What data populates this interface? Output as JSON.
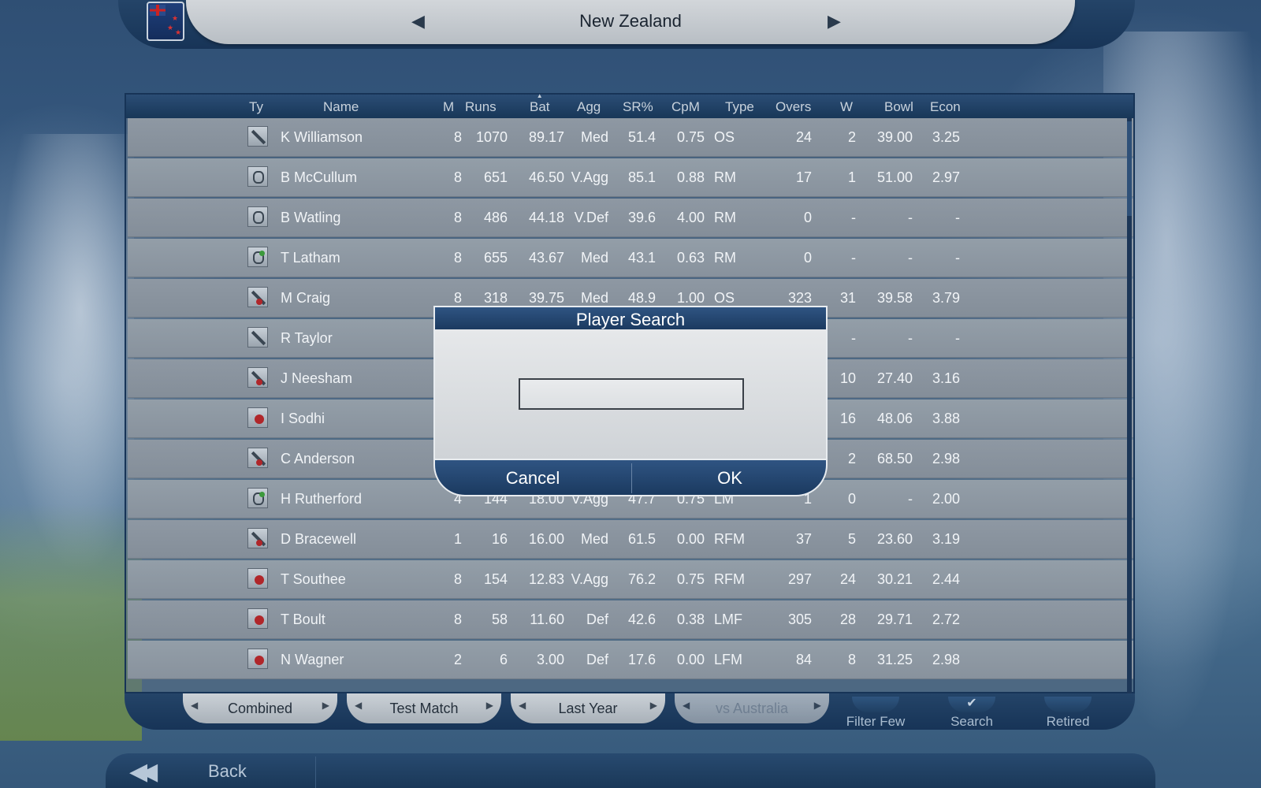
{
  "header": {
    "country": "New Zealand",
    "prev_arrow": "◀",
    "next_arrow": "▶"
  },
  "table": {
    "columns": [
      "Ty",
      "Name",
      "M",
      "Runs",
      "Bat",
      "Agg",
      "SR%",
      "CpM",
      "Type",
      "Overs",
      "W",
      "Bowl",
      "Econ"
    ],
    "sorted_column": "Bat",
    "rows": [
      {
        "ty": "batsman",
        "name": "K Williamson",
        "m": "8",
        "runs": "1070",
        "bat": "89.17",
        "agg": "Med",
        "sr": "51.4",
        "cpm": "0.75",
        "type": "OS",
        "overs": "24",
        "w": "2",
        "bowl": "39.00",
        "econ": "3.25"
      },
      {
        "ty": "keeper",
        "name": "B McCullum",
        "m": "8",
        "runs": "651",
        "bat": "46.50",
        "agg": "V.Agg",
        "sr": "85.1",
        "cpm": "0.88",
        "type": "RM",
        "overs": "17",
        "w": "1",
        "bowl": "51.00",
        "econ": "2.97"
      },
      {
        "ty": "keeper",
        "name": "B Watling",
        "m": "8",
        "runs": "486",
        "bat": "44.18",
        "agg": "V.Def",
        "sr": "39.6",
        "cpm": "4.00",
        "type": "RM",
        "overs": "0",
        "w": "-",
        "bowl": "-",
        "econ": "-"
      },
      {
        "ty": "keeper-alt",
        "name": "T Latham",
        "m": "8",
        "runs": "655",
        "bat": "43.67",
        "agg": "Med",
        "sr": "43.1",
        "cpm": "0.63",
        "type": "RM",
        "overs": "0",
        "w": "-",
        "bowl": "-",
        "econ": "-"
      },
      {
        "ty": "allrounder",
        "name": "M Craig",
        "m": "8",
        "runs": "318",
        "bat": "39.75",
        "agg": "Med",
        "sr": "48.9",
        "cpm": "1.00",
        "type": "OS",
        "overs": "323",
        "w": "31",
        "bowl": "39.58",
        "econ": "3.79"
      },
      {
        "ty": "batsman",
        "name": "R Taylor",
        "m": "",
        "runs": "",
        "bat": "",
        "agg": "",
        "sr": "",
        "cpm": "",
        "type": "",
        "overs": "",
        "w": "-",
        "bowl": "-",
        "econ": "-"
      },
      {
        "ty": "allrounder",
        "name": "J Neesham",
        "m": "",
        "runs": "",
        "bat": "",
        "agg": "",
        "sr": "",
        "cpm": "",
        "type": "",
        "overs": "",
        "w": "10",
        "bowl": "27.40",
        "econ": "3.16"
      },
      {
        "ty": "bowler",
        "name": "I Sodhi",
        "m": "",
        "runs": "",
        "bat": "",
        "agg": "",
        "sr": "",
        "cpm": "",
        "type": "",
        "overs": "",
        "w": "16",
        "bowl": "48.06",
        "econ": "3.88"
      },
      {
        "ty": "allrounder",
        "name": "C Anderson",
        "m": "",
        "runs": "",
        "bat": "",
        "agg": "",
        "sr": "",
        "cpm": "",
        "type": "",
        "overs": "",
        "w": "2",
        "bowl": "68.50",
        "econ": "2.98"
      },
      {
        "ty": "keeper-alt",
        "name": "H Rutherford",
        "m": "4",
        "runs": "144",
        "bat": "18.00",
        "agg": "V.Agg",
        "sr": "47.7",
        "cpm": "0.75",
        "type": "LM",
        "overs": "1",
        "w": "0",
        "bowl": "-",
        "econ": "2.00"
      },
      {
        "ty": "allrounder",
        "name": "D Bracewell",
        "m": "1",
        "runs": "16",
        "bat": "16.00",
        "agg": "Med",
        "sr": "61.5",
        "cpm": "0.00",
        "type": "RFM",
        "overs": "37",
        "w": "5",
        "bowl": "23.60",
        "econ": "3.19"
      },
      {
        "ty": "bowler",
        "name": "T Southee",
        "m": "8",
        "runs": "154",
        "bat": "12.83",
        "agg": "V.Agg",
        "sr": "76.2",
        "cpm": "0.75",
        "type": "RFM",
        "overs": "297",
        "w": "24",
        "bowl": "30.21",
        "econ": "2.44"
      },
      {
        "ty": "bowler",
        "name": "T Boult",
        "m": "8",
        "runs": "58",
        "bat": "11.60",
        "agg": "Def",
        "sr": "42.6",
        "cpm": "0.38",
        "type": "LMF",
        "overs": "305",
        "w": "28",
        "bowl": "29.71",
        "econ": "2.72"
      },
      {
        "ty": "bowler",
        "name": "N Wagner",
        "m": "2",
        "runs": "6",
        "bat": "3.00",
        "agg": "Def",
        "sr": "17.6",
        "cpm": "0.00",
        "type": "LFM",
        "overs": "84",
        "w": "8",
        "bowl": "31.25",
        "econ": "2.98"
      }
    ]
  },
  "filters": {
    "pills": [
      {
        "label": "Combined",
        "disabled": false
      },
      {
        "label": "Test Match",
        "disabled": false
      },
      {
        "label": "Last Year",
        "disabled": false
      },
      {
        "label": "vs Australia",
        "disabled": true
      }
    ],
    "buttons": [
      {
        "label": "Filter Few",
        "icon": "filter-icon",
        "glyph": ""
      },
      {
        "label": "Search",
        "icon": "check-icon",
        "glyph": "✔"
      },
      {
        "label": "Retired",
        "icon": "retired-icon",
        "glyph": ""
      }
    ]
  },
  "footer": {
    "back_label": "Back",
    "back_glyph": "◀◀"
  },
  "dialog": {
    "title": "Player Search",
    "input_value": "",
    "cancel_label": "Cancel",
    "ok_label": "OK"
  }
}
